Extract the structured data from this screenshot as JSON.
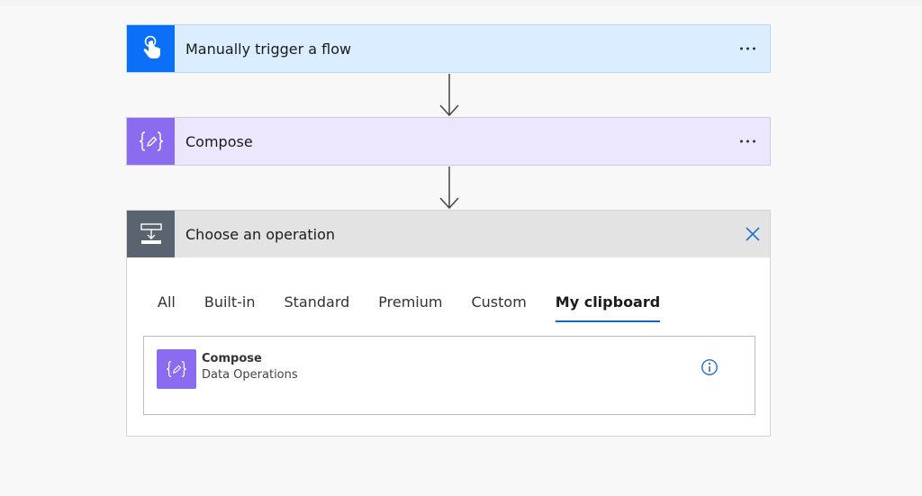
{
  "trigger": {
    "title": "Manually trigger a flow",
    "icon": "touch-hand-icon",
    "accent": "#0c6ff7"
  },
  "compose": {
    "title": "Compose",
    "icon": "braces-pencil-icon",
    "accent": "#8b6cf0"
  },
  "operation": {
    "title": "Choose an operation",
    "icon": "insert-step-icon",
    "tabs": [
      {
        "label": "All"
      },
      {
        "label": "Built-in"
      },
      {
        "label": "Standard"
      },
      {
        "label": "Premium"
      },
      {
        "label": "Custom"
      },
      {
        "label": "My clipboard"
      }
    ],
    "active_tab": "My clipboard",
    "results": [
      {
        "name": "Compose",
        "category": "Data Operations"
      }
    ]
  },
  "colors": {
    "link_blue": "#0f6cbd",
    "trigger_bg": "#dbeeff",
    "compose_bg": "#ece7fd",
    "operation_header_bg": "#e3e3e3"
  }
}
